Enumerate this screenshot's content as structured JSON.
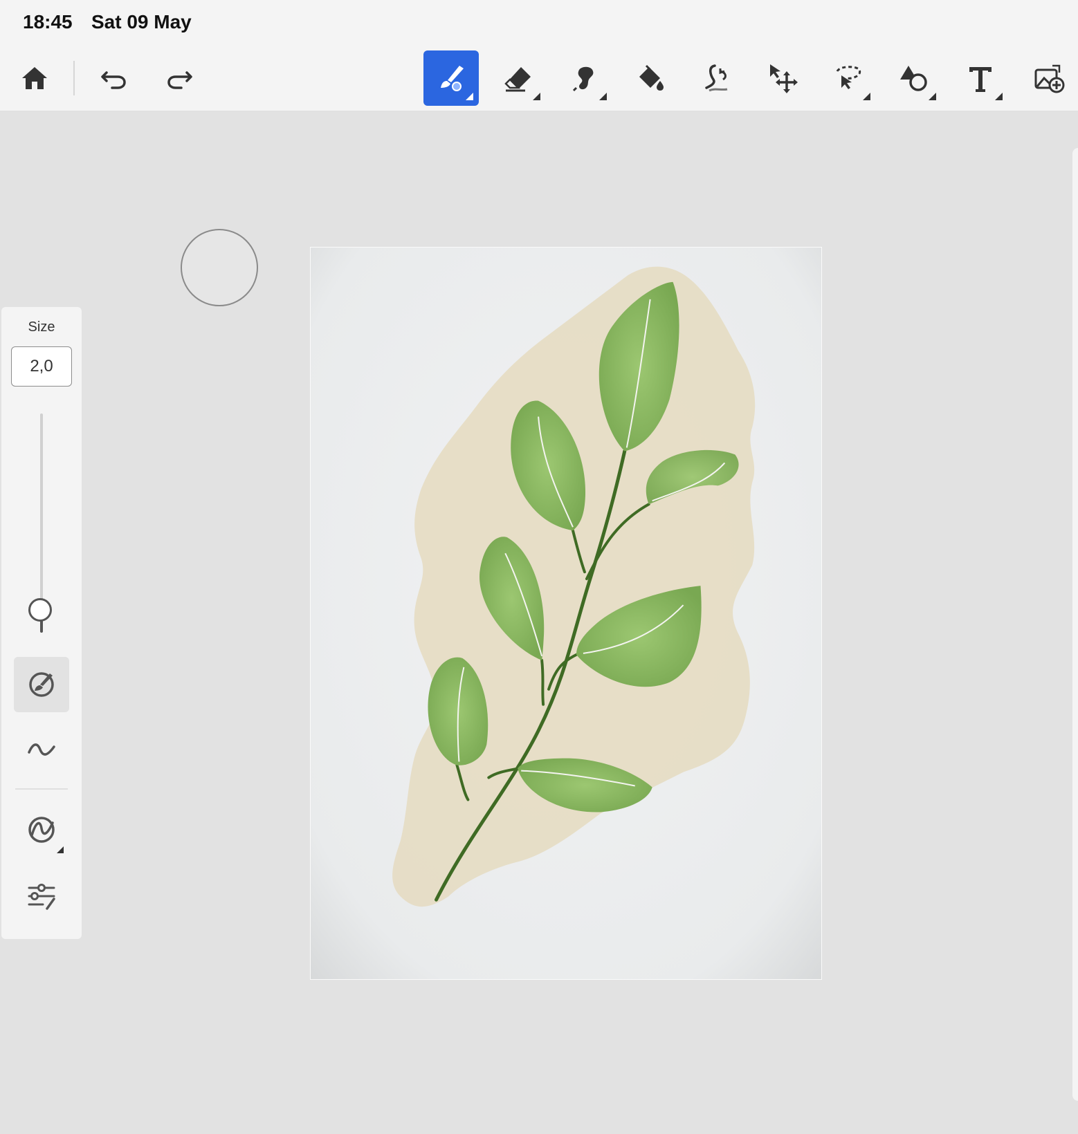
{
  "status_bar": {
    "time": "18:45",
    "date": "Sat 09 May"
  },
  "toolbar": {
    "left_tools": [
      {
        "id": "home",
        "icon": "home-icon"
      },
      {
        "id": "undo",
        "icon": "undo-icon"
      },
      {
        "id": "redo",
        "icon": "redo-icon"
      }
    ],
    "tools": [
      {
        "id": "paint-brush",
        "icon": "paint-brush-icon",
        "active": true
      },
      {
        "id": "eraser",
        "icon": "eraser-icon"
      },
      {
        "id": "smudge",
        "icon": "smudge-icon"
      },
      {
        "id": "fill",
        "icon": "paint-bucket-icon"
      },
      {
        "id": "liquify",
        "icon": "liquify-icon"
      },
      {
        "id": "transform",
        "icon": "move-transform-icon"
      },
      {
        "id": "selection",
        "icon": "lasso-select-icon"
      },
      {
        "id": "shape",
        "icon": "shapes-icon"
      },
      {
        "id": "text",
        "icon": "text-icon"
      },
      {
        "id": "place-image",
        "icon": "add-image-icon"
      }
    ]
  },
  "brush_panel": {
    "size_label": "Size",
    "size_value": "2,0",
    "size_slider_level": 0.9,
    "tools": [
      {
        "id": "brush-settings",
        "icon": "brush-pressure-icon",
        "selected": true
      },
      {
        "id": "smoothing",
        "icon": "wave-icon"
      },
      {
        "id": "brush-library",
        "icon": "brush-library-icon"
      },
      {
        "id": "brush-options",
        "icon": "sliders-icon"
      }
    ]
  },
  "colors": {
    "accent": "#2b66e0",
    "workspace": "#e2e2e2",
    "toolbar": "#f4f4f4",
    "paper": "#eef0f1",
    "wash": "#e8dfc8",
    "leaf": "#86b560",
    "stem": "#3f6b24"
  },
  "canvas": {
    "content": "green-leaf-branch-on-beige-watercolor-wash"
  }
}
